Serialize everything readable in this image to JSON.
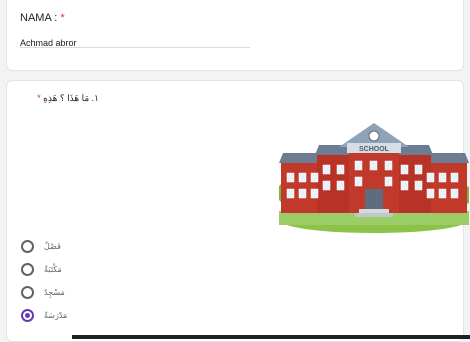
{
  "name_question": {
    "label": "NAMA :",
    "required_mark": "*",
    "answer": "Achmad abror"
  },
  "question_1": {
    "required_mark": "*",
    "text": "١. مَا هَذَا ؟ هَذِهِ",
    "image": {
      "caption": "SCHOOL",
      "icon": "school-building-illustration"
    },
    "options": [
      {
        "label": "فَصْلٌ",
        "checked": false
      },
      {
        "label": "مَكْتَبَةٌ",
        "checked": false
      },
      {
        "label": "مَسْجِدٌ",
        "checked": false
      },
      {
        "label": "مَدْرَسَةٌ",
        "checked": true
      }
    ]
  },
  "colors": {
    "accent": "#673ab7",
    "required": "#d93025",
    "background": "#f1f3f4"
  }
}
